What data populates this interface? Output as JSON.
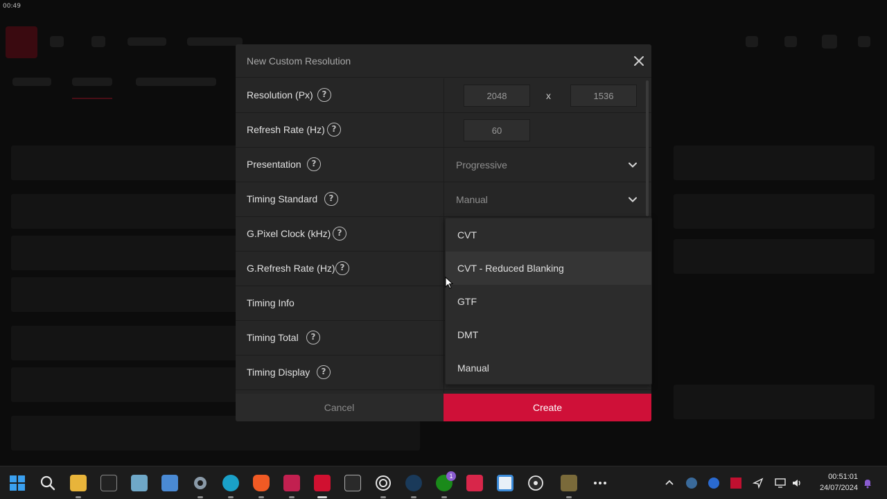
{
  "background": {
    "clock": "00:49"
  },
  "dialog": {
    "title": "New Custom Resolution",
    "rows": [
      {
        "label": "Resolution (Px)",
        "help": "?",
        "width": "2048",
        "separator": "x",
        "height": "1536"
      },
      {
        "label": "Refresh Rate (Hz)",
        "help": "?",
        "value": "60"
      },
      {
        "label": "Presentation",
        "help": "?",
        "value": "Progressive"
      },
      {
        "label": "Timing Standard",
        "help": "?",
        "value": "Manual"
      },
      {
        "label": "G.Pixel Clock (kHz)",
        "help": "?"
      },
      {
        "label": "G.Refresh Rate (Hz)",
        "help": "?"
      },
      {
        "label": "Timing Info"
      },
      {
        "label": "Timing Total",
        "help": "?"
      },
      {
        "label": "Timing Display",
        "help": "?"
      }
    ],
    "cancel_label": "Cancel",
    "create_label": "Create",
    "accent_color": "#cf1038"
  },
  "dropdown": {
    "options": [
      "CVT",
      "CVT - Reduced Blanking",
      "GTF",
      "DMT",
      "Manual"
    ],
    "hovered": "CVT - Reduced Blanking"
  },
  "taskbar": {
    "icons": [
      "windows-start-icon",
      "search-icon",
      "file-explorer-icon",
      "terminal-icon",
      "photos-icon",
      "control-panel-icon",
      "settings-icon",
      "edge-icon",
      "brave-icon",
      "forza-icon",
      "amd-adrenalin-icon",
      "epic-games-icon",
      "ubisoft-icon",
      "steam-icon",
      "xbox-icon",
      "autodesk-icon",
      "notepad-icon",
      "obs-icon",
      "game-icon",
      "more-icon"
    ],
    "xbox_badge": "1",
    "tray_time": "00:51:01",
    "tray_date": "24/07/2024"
  }
}
